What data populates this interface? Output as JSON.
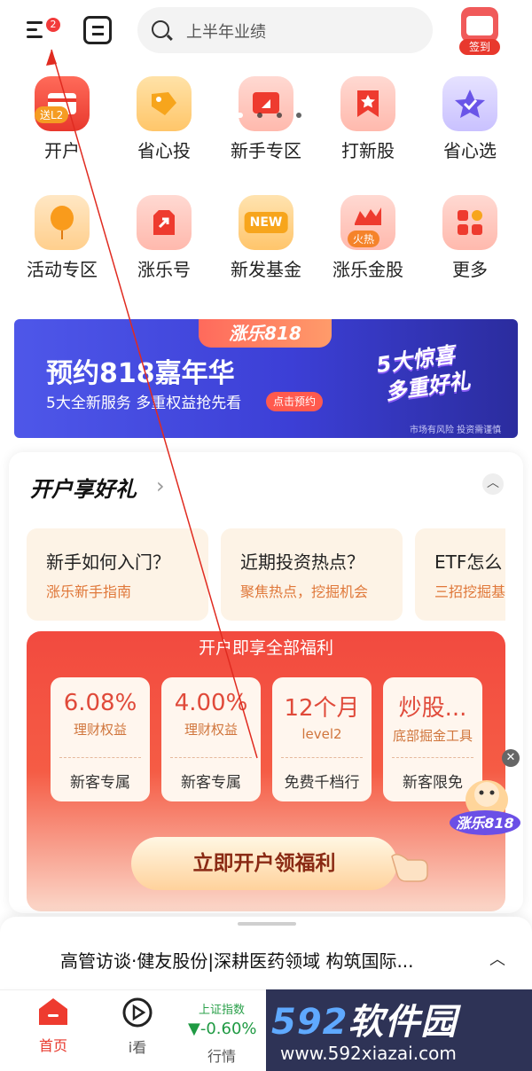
{
  "header": {
    "menu_badge": "2",
    "search_placeholder": "上半年业绩",
    "signin_label": "签到"
  },
  "grid_row1": [
    {
      "label": "开户",
      "tag": "送L2",
      "icon": "open-account-icon"
    },
    {
      "label": "省心投",
      "icon": "easy-invest-icon"
    },
    {
      "label": "新手专区",
      "icon": "newbie-zone-icon"
    },
    {
      "label": "打新股",
      "icon": "new-stock-icon"
    },
    {
      "label": "省心选",
      "icon": "easy-select-icon"
    }
  ],
  "grid_row2": [
    {
      "label": "活动专区",
      "icon": "activity-zone-icon"
    },
    {
      "label": "涨乐号",
      "icon": "zhangle-hao-icon"
    },
    {
      "label": "新发基金",
      "tag": "NEW",
      "icon": "new-fund-icon"
    },
    {
      "label": "涨乐金股",
      "tag": "火热",
      "icon": "golden-stock-icon"
    },
    {
      "label": "更多",
      "icon": "more-icon"
    }
  ],
  "banner": {
    "chip": "涨乐818",
    "title": "预约818嘉年华",
    "subtitle": "5大全新服务 多重权益抢先看",
    "button": "点击预约",
    "big1": "5大惊喜",
    "big2": "多重好礼",
    "note": "市场有风险 投资需谨慎"
  },
  "card": {
    "title": "开户享好礼",
    "guides": [
      {
        "title": "新手如何入门？",
        "subtitle": "涨乐新手指南"
      },
      {
        "title": "近期投资热点？",
        "subtitle": "聚焦热点，挖掘机会"
      },
      {
        "title": "ETF怎么",
        "subtitle": "三招挖掘基"
      }
    ],
    "benefit_header": "开户即享全部福利",
    "benefits": [
      {
        "value": "6.08%",
        "desc": "理财权益",
        "tag": "新客专属"
      },
      {
        "value": "4.00%",
        "desc": "理财权益",
        "tag": "新客专属"
      },
      {
        "value": "12个月",
        "desc": "level2",
        "tag": "免费千档行"
      },
      {
        "value": "炒股...",
        "desc": "底部掘金工具",
        "tag": "新客限免"
      }
    ],
    "cta": "立即开户领福利"
  },
  "float_badge": "涨乐818",
  "news": {
    "text": "高管访谈·健友股份|深耕医药领域 构筑国际..."
  },
  "tabbar": {
    "home": "首页",
    "watch": "i看",
    "index_name": "上证指数",
    "index_value": "▼-0.60%",
    "quotes": "行情"
  },
  "watermark": {
    "num": "592",
    "text": "软件园",
    "url": "www.592xiazai.com"
  },
  "colors": {
    "brand_red": "#e8382d",
    "down_green": "#1f9a43",
    "banner_blue": "#4e57e9"
  }
}
